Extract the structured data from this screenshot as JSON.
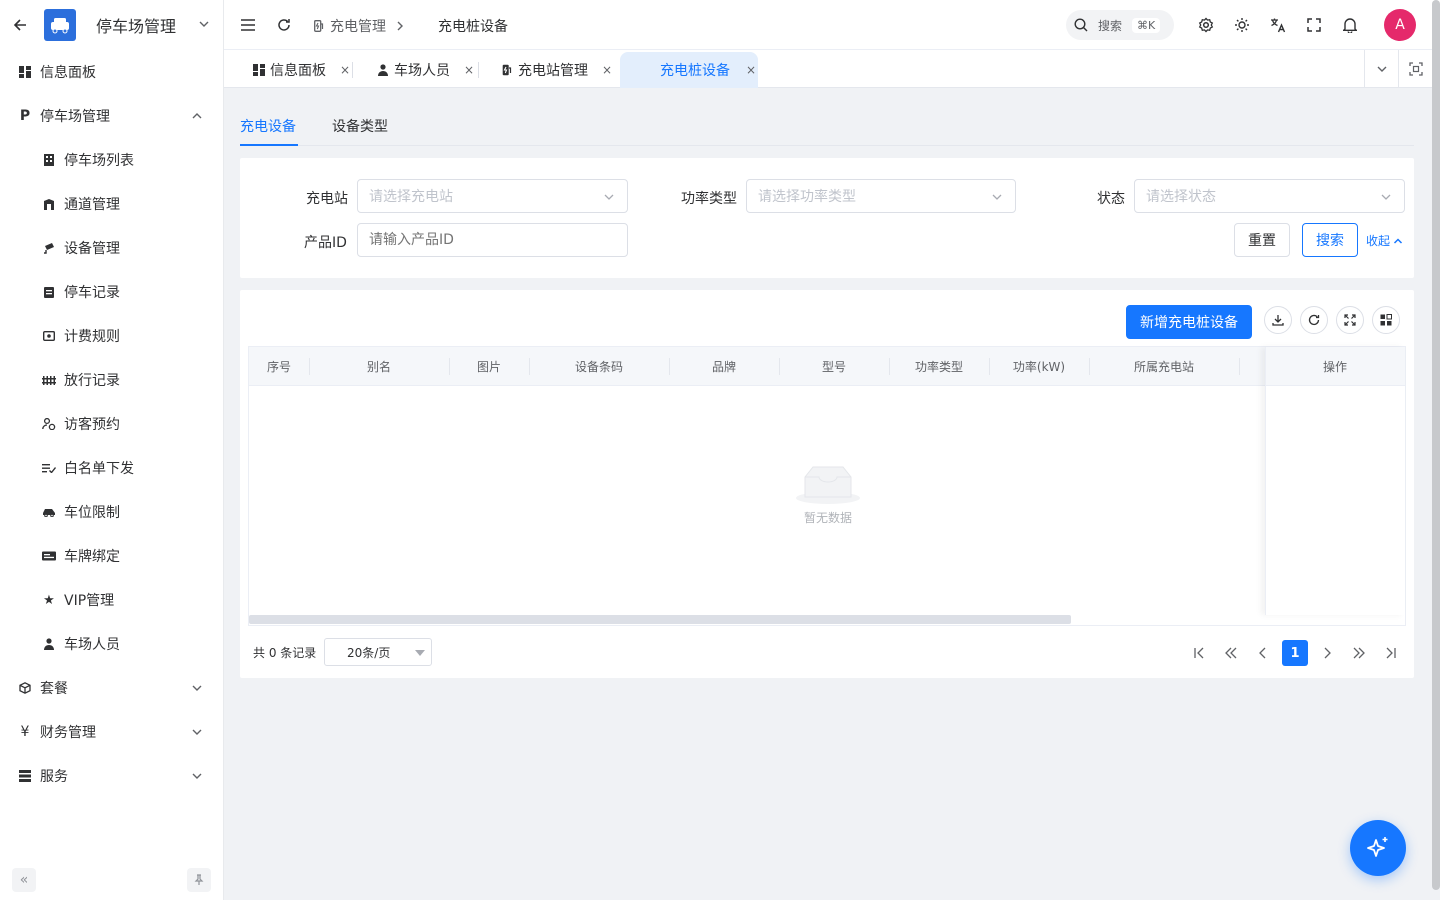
{
  "sidebar": {
    "app_title": "停车场管理",
    "items": [
      {
        "label": "信息面板",
        "icon": "dashboard-icon"
      },
      {
        "label": "停车场管理",
        "icon": "parking-icon",
        "expanded": true
      },
      {
        "label": "停车场列表",
        "icon": "building-icon"
      },
      {
        "label": "通道管理",
        "icon": "gate-icon"
      },
      {
        "label": "设备管理",
        "icon": "camera-icon"
      },
      {
        "label": "停车记录",
        "icon": "clipboard-icon"
      },
      {
        "label": "计费规则",
        "icon": "money-icon"
      },
      {
        "label": "放行记录",
        "icon": "fence-icon"
      },
      {
        "label": "访客预约",
        "icon": "visitor-icon"
      },
      {
        "label": "白名单下发",
        "icon": "checklist-icon"
      },
      {
        "label": "车位限制",
        "icon": "car-limit-icon"
      },
      {
        "label": "车牌绑定",
        "icon": "plate-icon"
      },
      {
        "label": "VIP管理",
        "icon": "star-icon"
      },
      {
        "label": "车场人员",
        "icon": "person-icon"
      },
      {
        "label": "套餐",
        "icon": "package-icon"
      },
      {
        "label": "财务管理",
        "icon": "yen-icon"
      },
      {
        "label": "服务",
        "icon": "server-icon"
      }
    ]
  },
  "header": {
    "breadcrumb_parent": "充电管理",
    "breadcrumb_current": "充电桩设备",
    "search_label": "搜索",
    "search_shortcut": "⌘K",
    "avatar_initial": "A"
  },
  "tabs": [
    {
      "label": "信息面板",
      "icon": "dashboard-icon",
      "close": "×"
    },
    {
      "label": "车场人员",
      "icon": "person-icon",
      "close": "×"
    },
    {
      "label": "充电站管理",
      "icon": "charging-station-icon",
      "close": "×"
    },
    {
      "label": "充电桩设备",
      "icon": "",
      "close": "×",
      "active": true
    }
  ],
  "subtabs": [
    "充电设备",
    "设备类型"
  ],
  "filters": {
    "station_label": "充电站",
    "station_placeholder": "请选择充电站",
    "power_type_label": "功率类型",
    "power_type_placeholder": "请选择功率类型",
    "status_label": "状态",
    "status_placeholder": "请选择状态",
    "product_id_label": "产品ID",
    "product_id_placeholder": "请输入产品ID",
    "reset_label": "重置",
    "search_label": "搜索",
    "collapse_label": "收起"
  },
  "toolbar": {
    "add_label": "新增充电桩设备"
  },
  "table": {
    "columns": [
      "序号",
      "别名",
      "图片",
      "设备条码",
      "品牌",
      "型号",
      "功率类型",
      "功率(kW)",
      "所属充电站",
      "操作"
    ],
    "rows": [],
    "empty_text": "暂无数据"
  },
  "pagination": {
    "total_text": "共 0 条记录",
    "page_size": "20条/页",
    "current_page": "1"
  },
  "colors": {
    "primary": "#1677ff",
    "avatar": "#e5296b",
    "logo": "#2c6fdc"
  }
}
